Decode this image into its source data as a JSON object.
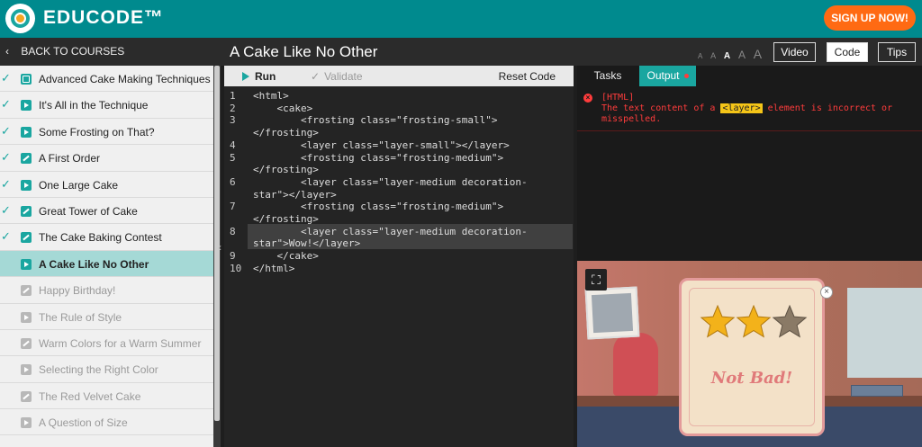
{
  "header": {
    "brand": "EDUCODE™",
    "signup_label": "SIGN UP NOW!"
  },
  "sidebar": {
    "back_label": "BACK TO COURSES",
    "items": [
      {
        "label": "Advanced Cake Making Techniques",
        "icon": "image-icon",
        "done": true
      },
      {
        "label": "It's All in the Technique",
        "icon": "play-icon",
        "done": true
      },
      {
        "label": "Some Frosting on That?",
        "icon": "play-icon",
        "done": true
      },
      {
        "label": "A First Order",
        "icon": "pencil-icon",
        "done": true
      },
      {
        "label": "One Large Cake",
        "icon": "play-icon",
        "done": true
      },
      {
        "label": "Great Tower of Cake",
        "icon": "pencil-icon",
        "done": true
      },
      {
        "label": "The Cake Baking Contest",
        "icon": "pencil-icon",
        "done": true
      },
      {
        "label": "A Cake Like No Other",
        "icon": "play-icon",
        "done": false,
        "active": true
      },
      {
        "label": "Happy Birthday!",
        "icon": "pencil-icon",
        "done": false
      },
      {
        "label": "The Rule of Style",
        "icon": "play-icon",
        "done": false
      },
      {
        "label": "Warm Colors for a Warm Summer",
        "icon": "pencil-icon",
        "done": false
      },
      {
        "label": "Selecting the Right Color",
        "icon": "play-icon",
        "done": false
      },
      {
        "label": "The Red Velvet Cake",
        "icon": "pencil-icon",
        "done": false
      },
      {
        "label": "A Question of Size",
        "icon": "play-icon",
        "done": false
      }
    ]
  },
  "titlebar": {
    "title": "A Cake Like No Other",
    "font_sizes": [
      "A",
      "A",
      "A",
      "A",
      "A"
    ],
    "video_label": "Video",
    "code_label": "Code",
    "tips_label": "Tips"
  },
  "editor": {
    "run_label": "Run",
    "validate_label": "Validate",
    "reset_label": "Reset Code",
    "line_numbers": [
      "1",
      "2",
      "3",
      "4",
      "5",
      "6",
      "7",
      "8",
      "9",
      "10"
    ],
    "lines": [
      "<html>",
      "    <cake>",
      "        <frosting class=\"frosting-small\">",
      "</frosting>",
      "        <layer class=\"layer-small\"></layer>",
      "        <frosting class=\"frosting-medium\">",
      "</frosting>",
      "        <layer class=\"layer-medium decoration-",
      "star\"></layer>",
      "        <frosting class=\"frosting-medium\">",
      "</frosting>",
      "        <layer class=\"layer-medium decoration-",
      "star\">Wow!</layer>",
      "    </cake>",
      "</html>"
    ]
  },
  "panel": {
    "tasks_label": "Tasks",
    "output_label": "Output",
    "error_tag": "[HTML]",
    "error_pre": "The text content of a ",
    "error_code": "<layer>",
    "error_post": " element is incorrect or misspelled."
  },
  "preview": {
    "message": "Not Bad!",
    "stars_earned": 2,
    "stars_total": 3,
    "colors": {
      "star_gold": "#f3b21a",
      "star_empty": "#8a7a66",
      "accent": "#1aa6a0"
    }
  }
}
